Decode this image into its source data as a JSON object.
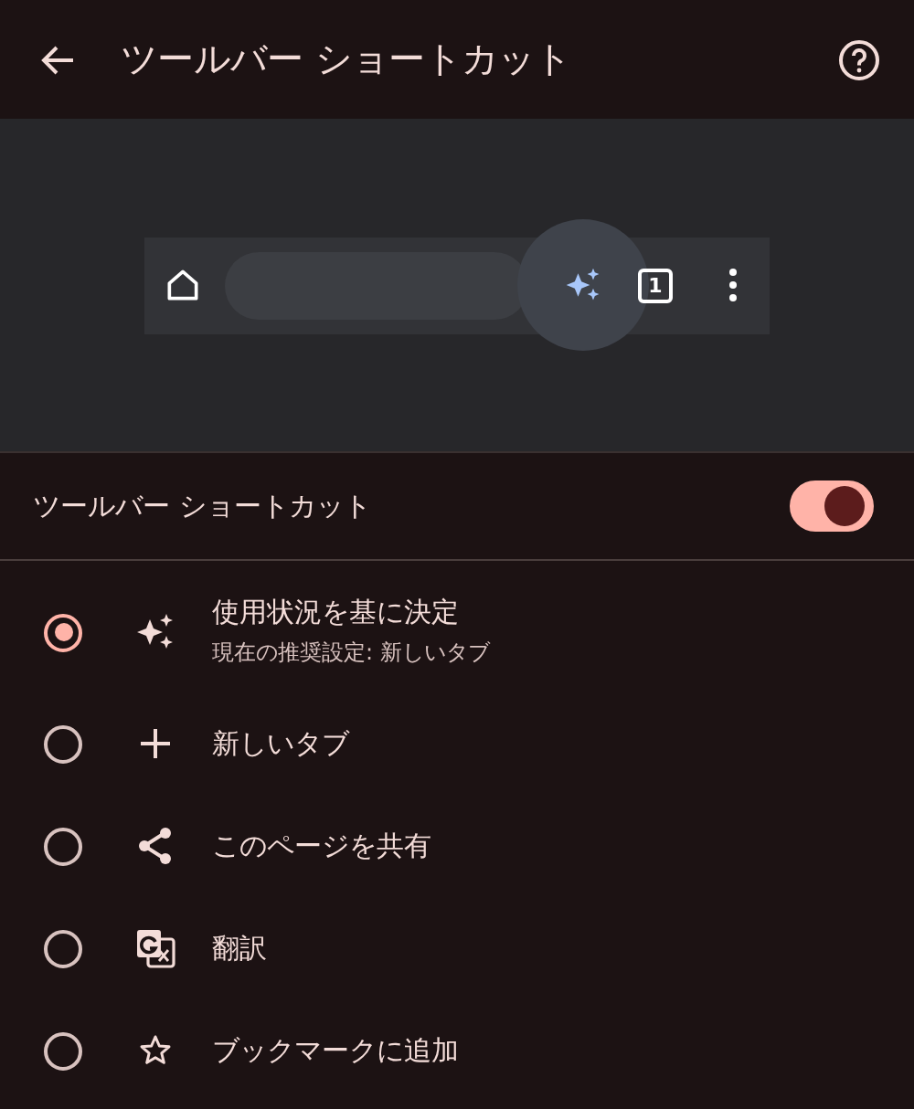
{
  "header": {
    "title": "ツールバー ショートカット"
  },
  "preview": {
    "tab_count": "1"
  },
  "toggle": {
    "label": "ツールバー ショートカット",
    "on": true
  },
  "options": [
    {
      "kind": "sparkle",
      "label": "使用状況を基に決定",
      "subtitle": "現在の推奨設定: 新しいタブ",
      "selected": true
    },
    {
      "kind": "plus",
      "label": "新しいタブ",
      "selected": false
    },
    {
      "kind": "share",
      "label": "このページを共有",
      "selected": false
    },
    {
      "kind": "translate",
      "label": "翻訳",
      "selected": false
    },
    {
      "kind": "star",
      "label": "ブックマークに追加",
      "selected": false
    }
  ]
}
